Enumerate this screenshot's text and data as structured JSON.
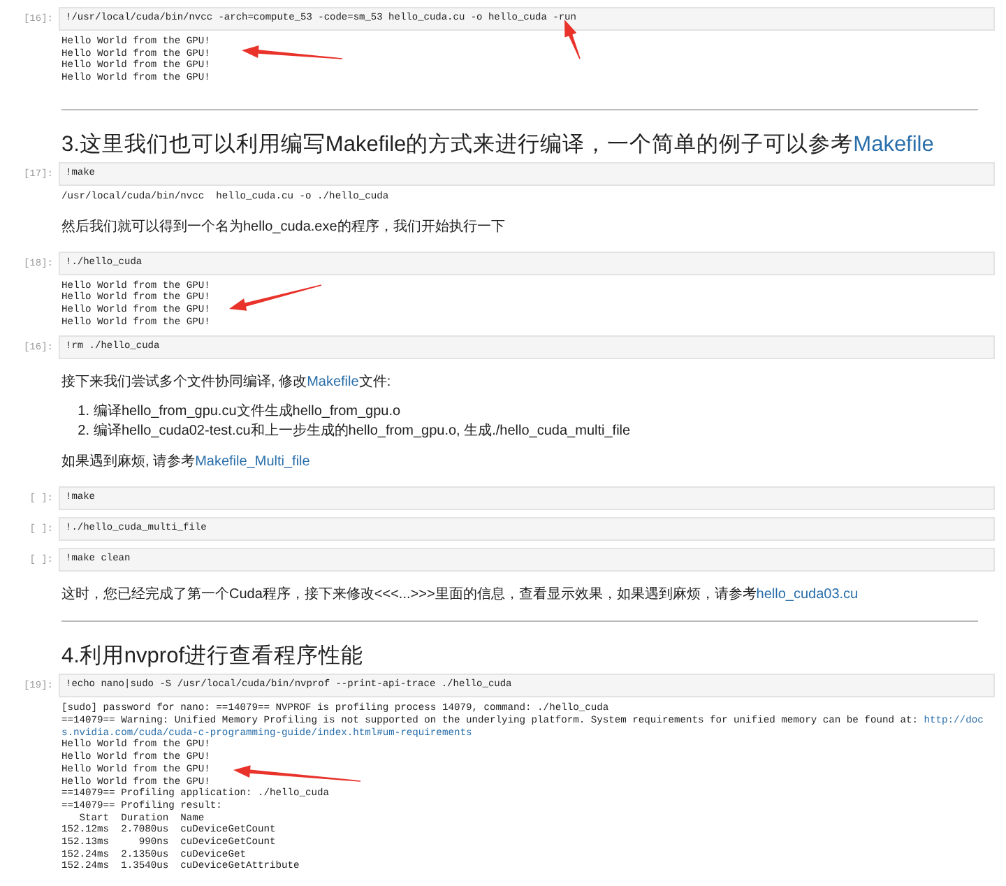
{
  "cells": [
    {
      "kind": "code",
      "prompt": "[16]:",
      "source": "!/usr/local/cuda/bin/nvcc -arch=compute_53 -code=sm_53 hello_cuda.cu -o hello_cuda -run",
      "outputs": [
        "Hello World from the GPU!",
        "Hello World from the GPU!",
        "Hello World from the GPU!",
        "Hello World from the GPU!"
      ]
    },
    {
      "kind": "markdown",
      "blocks": [
        {
          "kind": "rule"
        },
        {
          "kind": "heading",
          "parts": [
            {
              "text": "3.这里我们也可以利用编写Makefile的方式来进行编译，一个简单的例子可以参考"
            },
            {
              "text": "Makefile",
              "link": true
            }
          ]
        }
      ]
    },
    {
      "kind": "code",
      "prompt": "[17]:",
      "source": "!make",
      "outputs": [
        "/usr/local/cuda/bin/nvcc  hello_cuda.cu -o ./hello_cuda"
      ]
    },
    {
      "kind": "markdown",
      "blocks": [
        {
          "kind": "paragraph",
          "parts": [
            {
              "text": "然后我们就可以得到一个名为hello_cuda.exe的程序，我们开始执行一下"
            }
          ]
        }
      ]
    },
    {
      "kind": "code",
      "prompt": "[18]:",
      "source": "!./hello_cuda",
      "outputs": [
        "Hello World from the GPU!",
        "Hello World from the GPU!",
        "Hello World from the GPU!",
        "Hello World from the GPU!"
      ]
    },
    {
      "kind": "code",
      "prompt": "[16]:",
      "source": "!rm ./hello_cuda"
    },
    {
      "kind": "markdown",
      "blocks": [
        {
          "kind": "paragraph",
          "parts": [
            {
              "text": "接下来我们尝试多个文件协同编译, 修改"
            },
            {
              "text": "Makefile",
              "link": true
            },
            {
              "text": "文件:"
            }
          ]
        },
        {
          "kind": "list",
          "items": [
            {
              "marker": "1.",
              "text": "编译hello_from_gpu.cu文件生成hello_from_gpu.o"
            },
            {
              "marker": "2.",
              "text": "编译hello_cuda02-test.cu和上一步生成的hello_from_gpu.o, 生成./hello_cuda_multi_file"
            }
          ]
        },
        {
          "kind": "paragraph",
          "parts": [
            {
              "text": "如果遇到麻烦, 请参考"
            },
            {
              "text": "Makefile_Multi_file",
              "link": true
            }
          ]
        }
      ]
    },
    {
      "kind": "code",
      "prompt": "[ ]:",
      "source": "!make"
    },
    {
      "kind": "code",
      "prompt": "[ ]:",
      "source": "!./hello_cuda_multi_file"
    },
    {
      "kind": "code",
      "prompt": "[ ]:",
      "source": "!make clean"
    },
    {
      "kind": "markdown",
      "blocks": [
        {
          "kind": "paragraph",
          "parts": [
            {
              "text": "这时，您已经完成了第一个Cuda程序，接下来修改<<<...>>>里面的信息，查看显示效果，如果遇到麻烦，请参考"
            },
            {
              "text": "hello_cuda03.cu",
              "link": true
            }
          ]
        },
        {
          "kind": "rule"
        },
        {
          "kind": "heading",
          "parts": [
            {
              "text": "4.利用nvprof进行查看程序性能"
            }
          ]
        }
      ]
    },
    {
      "kind": "code",
      "prompt": "[19]:",
      "source": "!echo nano|sudo -S /usr/local/cuda/bin/nvprof --print-api-trace ./hello_cuda",
      "outputs": [
        "[sudo] password for nano: ==14079== NVPROF is profiling process 14079, command: ./hello_cuda",
        {
          "parts": [
            {
              "text": "==14079== Warning: Unified Memory Profiling is not supported on the underlying platform. System requirements for unified memory can be found at: "
            },
            {
              "text": "http://doc",
              "link": true
            }
          ]
        },
        {
          "parts": [
            {
              "text": "s.nvidia.com/cuda/cuda-c-programming-guide/index.html#um-requirements",
              "link": true
            }
          ]
        },
        "Hello World from the GPU!",
        "Hello World from the GPU!",
        "Hello World from the GPU!",
        "Hello World from the GPU!",
        "==14079== Profiling application: ./hello_cuda",
        "==14079== Profiling result:",
        "   Start  Duration  Name",
        "152.12ms  2.7080us  cuDeviceGetCount",
        "152.13ms     990ns  cuDeviceGetCount",
        "152.24ms  2.1350us  cuDeviceGet",
        "152.24ms  1.3540us  cuDeviceGetAttribute"
      ]
    }
  ]
}
